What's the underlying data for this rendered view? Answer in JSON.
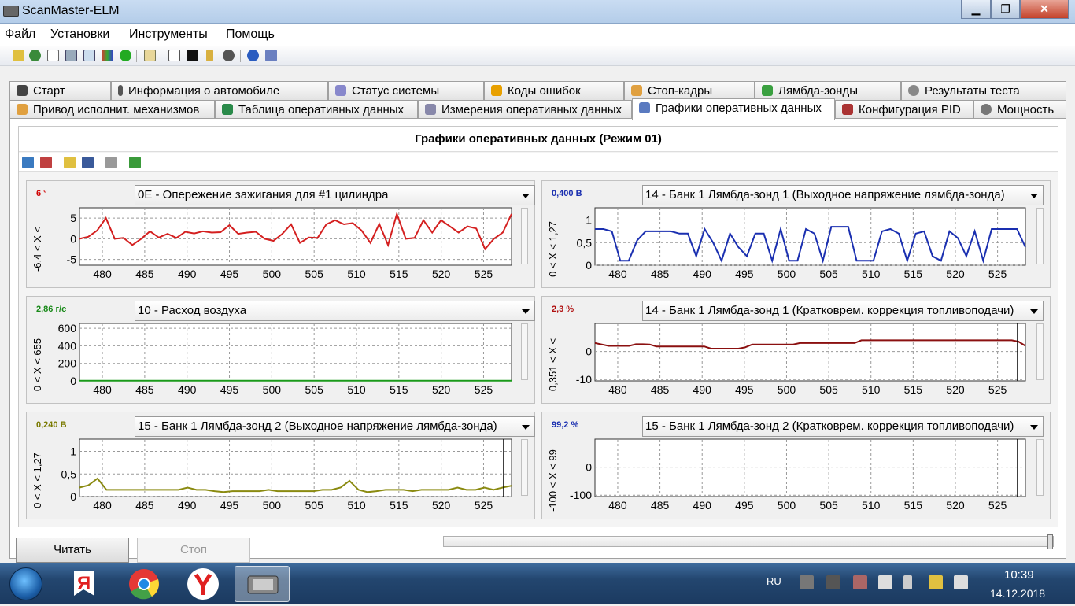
{
  "window": {
    "title": "ScanMaster-ELM",
    "min": "▁",
    "max": "❐",
    "close": "✕"
  },
  "menu": [
    "Файл",
    "Установки",
    "Инструменты",
    "Помощь"
  ],
  "tabs_row1": [
    "Старт",
    "Информация о автомобиле",
    "Статус системы",
    "Коды ошибок",
    "Стоп-кадры",
    "Лямбда-зонды",
    "Результаты теста"
  ],
  "tabs_row2": [
    "Привод исполнит. механизмов",
    "Таблица оперативных данных",
    "Измерения оперативных данных",
    "Графики оперативных данных",
    "Конфигурация PID",
    "Мощность"
  ],
  "active_tab": "Графики оперативных данных",
  "page_title": "Графики оперативных данных (Режим 01)",
  "x_ticks": [
    "480",
    "485",
    "490",
    "495",
    "500",
    "505",
    "510",
    "515",
    "520",
    "525"
  ],
  "charts": [
    {
      "value": "6 °",
      "value_color": "#d00000",
      "pid": "0E - Опережение зажигания для #1 цилиндра",
      "line_color": "#d42020",
      "axis_label": "-6,4  < X <",
      "y_ticks": [
        "5",
        "0",
        "-5"
      ],
      "y_range": [
        -6.4,
        7.5
      ],
      "points": [
        0,
        0.5,
        2,
        5,
        0,
        0.2,
        -1.5,
        0,
        1.8,
        0.3,
        1.2,
        0.2,
        1.7,
        1.3,
        1.8,
        1.5,
        1.6,
        3.3,
        1.2,
        1.5,
        1.7,
        0,
        -0.5,
        1.2,
        3.5,
        -1,
        0.3,
        0.2,
        3.5,
        4.5,
        3.5,
        3.8,
        2,
        -1,
        3.6,
        -1.5,
        6,
        0,
        0.2,
        4.5,
        1.5,
        4.5,
        3,
        1.5,
        3,
        2.5,
        -2.5,
        0,
        1.5,
        6
      ],
      "cursor": false
    },
    {
      "value": "0,400 В",
      "value_color": "#1a2fb0",
      "pid": "14 - Банк 1 Лямбда-зонд 1 (Выходное напряжение лямбда-зонда)",
      "line_color": "#1a2fb0",
      "axis_label": "0  < X < 1,27",
      "y_ticks": [
        "1",
        "0,5",
        "0"
      ],
      "y_range": [
        0,
        1.27
      ],
      "points": [
        0.8,
        0.8,
        0.75,
        0.1,
        0.1,
        0.55,
        0.75,
        0.75,
        0.75,
        0.75,
        0.7,
        0.7,
        0.2,
        0.8,
        0.5,
        0.1,
        0.7,
        0.4,
        0.2,
        0.7,
        0.7,
        0.1,
        0.8,
        0.1,
        0.1,
        0.8,
        0.7,
        0.1,
        0.85,
        0.85,
        0.85,
        0.1,
        0.1,
        0.1,
        0.75,
        0.8,
        0.7,
        0.1,
        0.7,
        0.75,
        0.2,
        0.1,
        0.75,
        0.6,
        0.2,
        0.75,
        0.1,
        0.8,
        0.8,
        0.8,
        0.8,
        0.4
      ],
      "cursor": false
    },
    {
      "value": "2,86 г/с",
      "value_color": "#1a8a1a",
      "pid": "10 - Расход воздуха",
      "line_color": "#1a9a1a",
      "axis_label": "0  < X < 655",
      "y_ticks": [
        "600",
        "400",
        "200",
        "0"
      ],
      "y_range": [
        0,
        655
      ],
      "points": [
        3,
        3,
        3,
        3,
        3,
        3,
        3,
        3,
        3,
        3,
        3,
        3,
        3,
        3,
        3,
        3,
        3,
        3,
        3,
        3,
        3,
        3,
        3,
        3,
        3,
        3,
        3,
        3,
        3,
        3,
        3,
        3,
        3,
        3,
        3,
        3,
        3,
        3,
        3,
        3,
        3,
        3,
        3,
        3,
        3,
        3,
        3,
        3,
        3,
        3
      ],
      "cursor": false
    },
    {
      "value": "2,3 %",
      "value_color": "#b01010",
      "pid": "14 - Банк 1 Лямбда-зонд 1 (Кратковрем. коррекция топливоподачи)",
      "line_color": "#8b1010",
      "axis_label": "0,351  < X <",
      "y_ticks": [
        "0",
        "-10"
      ],
      "y_range": [
        -10.5,
        10
      ],
      "points": [
        3,
        2.5,
        2,
        2,
        2,
        2,
        2.6,
        2.6,
        2.5,
        1.8,
        1.8,
        1.8,
        1.8,
        1.8,
        1.8,
        1.8,
        1.8,
        1,
        1,
        1,
        1,
        1,
        1.5,
        2.5,
        2.5,
        2.5,
        2.5,
        2.5,
        2.5,
        2.5,
        3,
        3,
        3,
        3,
        3,
        3,
        3,
        3,
        3,
        4,
        4,
        4,
        4,
        4,
        4,
        4,
        4,
        4,
        4,
        4,
        4,
        4,
        4,
        4,
        4,
        4,
        4,
        4,
        4,
        4,
        4,
        4,
        3.5,
        2
      ],
      "cursor": true
    },
    {
      "value": "0,240 В",
      "value_color": "#7a7a00",
      "pid": "15 - Банк 1 Лямбда-зонд 2 (Выходное напряжение лямбда-зонда)",
      "line_color": "#8a8a10",
      "axis_label": "0  < X < 1,27",
      "y_ticks": [
        "1",
        "0,5",
        "0"
      ],
      "y_range": [
        0,
        1.27
      ],
      "points": [
        0.2,
        0.25,
        0.4,
        0.15,
        0.15,
        0.15,
        0.15,
        0.15,
        0.15,
        0.15,
        0.15,
        0.15,
        0.2,
        0.15,
        0.15,
        0.12,
        0.1,
        0.12,
        0.12,
        0.12,
        0.12,
        0.15,
        0.12,
        0.12,
        0.12,
        0.12,
        0.12,
        0.15,
        0.15,
        0.2,
        0.35,
        0.15,
        0.1,
        0.12,
        0.15,
        0.15,
        0.15,
        0.12,
        0.15,
        0.15,
        0.15,
        0.15,
        0.2,
        0.15,
        0.15,
        0.2,
        0.15,
        0.2,
        0.24
      ],
      "cursor": true
    },
    {
      "value": "99,2 %",
      "value_color": "#1a2fb0",
      "pid": "15 - Банк 1 Лямбда-зонд 2 (Кратковрем. коррекция топливоподачи)",
      "line_color": "#1a2fb0",
      "axis_label": "-100  < X < 99",
      "y_ticks": [
        "0",
        "-100"
      ],
      "y_range": [
        -105,
        100
      ],
      "points": [],
      "cursor": true
    }
  ],
  "buttons": {
    "read": "Читать",
    "stop": "Стоп"
  },
  "taskbar": {
    "lang": "RU",
    "time": "10:39",
    "date": "14.12.2018"
  }
}
